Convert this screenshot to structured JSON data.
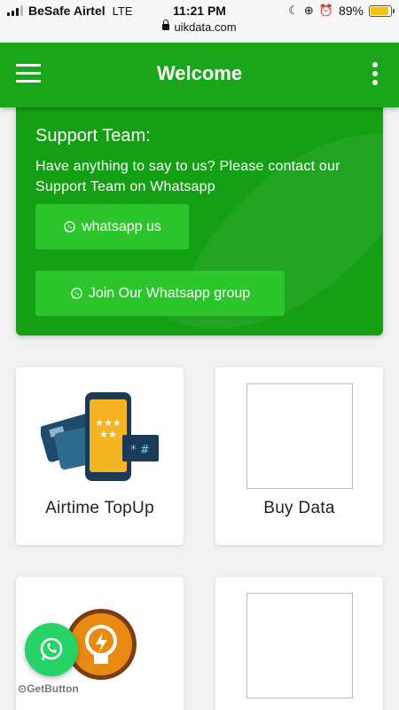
{
  "status_bar": {
    "carrier": "BeSafe Airtel",
    "network": "LTE",
    "time": "11:21 PM",
    "url": "uikdata.com",
    "battery_percent": "89%",
    "battery_level": 0.89,
    "icons": [
      "signal-icon",
      "moon-icon",
      "rotation-lock-icon",
      "alarm-icon",
      "battery-icon"
    ]
  },
  "header": {
    "title": "Welcome",
    "color": "#1aa61a"
  },
  "support": {
    "title": "Support Team:",
    "text": "Have anything to say to us? Please contact our Support Team on Whatsapp",
    "buttons": [
      {
        "label": "whatsapp us",
        "icon": "whatsapp-icon"
      },
      {
        "label": "Join Our Whatsapp group",
        "icon": "whatsapp-icon"
      }
    ],
    "color": "#149f14"
  },
  "tiles": [
    {
      "label": "Airtime TopUp",
      "icon": "airtime-topup-icon"
    },
    {
      "label": "Buy Data",
      "icon": "image-placeholder"
    },
    {
      "label": "",
      "icon": "electricity-bulb-icon"
    },
    {
      "label": "",
      "icon": "image-placeholder"
    }
  ],
  "floating": {
    "icon": "whatsapp-icon",
    "brand": "GetButton"
  }
}
